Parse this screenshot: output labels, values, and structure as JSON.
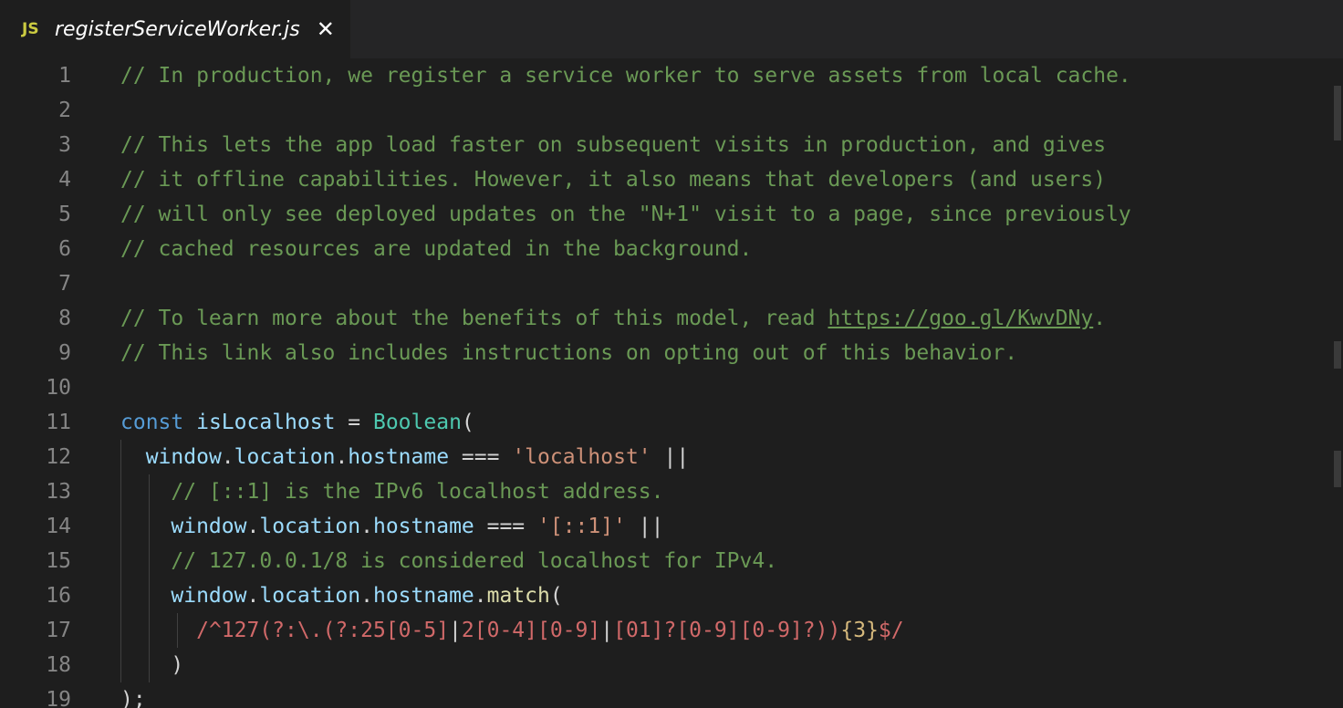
{
  "tab": {
    "badge": "JS",
    "title": "registerServiceWorker.js",
    "close": "✕"
  },
  "editor": {
    "line_numbers": [
      "1",
      "2",
      "3",
      "4",
      "5",
      "6",
      "7",
      "8",
      "9",
      "10",
      "11",
      "12",
      "13",
      "14",
      "15",
      "16",
      "17",
      "18",
      "19"
    ],
    "lines": [
      {
        "tokens": [
          {
            "t": "// In production, we register a service worker to serve assets from local cache.",
            "c": "c"
          }
        ]
      },
      {
        "tokens": []
      },
      {
        "tokens": [
          {
            "t": "// This lets the app load faster on subsequent visits in production, and gives",
            "c": "c"
          }
        ]
      },
      {
        "tokens": [
          {
            "t": "// it offline capabilities. However, it also means that developers (and users)",
            "c": "c"
          }
        ]
      },
      {
        "tokens": [
          {
            "t": "// will only see deployed updates on the \"N+1\" visit to a page, since previously",
            "c": "c"
          }
        ]
      },
      {
        "tokens": [
          {
            "t": "// cached resources are updated in the background.",
            "c": "c"
          }
        ]
      },
      {
        "tokens": []
      },
      {
        "tokens": [
          {
            "t": "// To learn more about the benefits of this model, read ",
            "c": "c"
          },
          {
            "t": "https://goo.gl/KwvDNy",
            "c": "c-link"
          },
          {
            "t": ".",
            "c": "c"
          }
        ]
      },
      {
        "tokens": [
          {
            "t": "// This link also includes instructions on opting out of this behavior.",
            "c": "c"
          }
        ]
      },
      {
        "tokens": []
      },
      {
        "tokens": [
          {
            "t": "const",
            "c": "kw"
          },
          {
            "t": " ",
            "c": "op"
          },
          {
            "t": "isLocalhost",
            "c": "var"
          },
          {
            "t": " = ",
            "c": "op"
          },
          {
            "t": "Boolean",
            "c": "type"
          },
          {
            "t": "(",
            "c": "op"
          }
        ]
      },
      {
        "tokens": [
          {
            "t": "  ",
            "c": "op"
          },
          {
            "t": "window",
            "c": "var"
          },
          {
            "t": ".",
            "c": "op"
          },
          {
            "t": "location",
            "c": "var"
          },
          {
            "t": ".",
            "c": "op"
          },
          {
            "t": "hostname",
            "c": "var"
          },
          {
            "t": " === ",
            "c": "op"
          },
          {
            "t": "'localhost'",
            "c": "str"
          },
          {
            "t": " ||",
            "c": "op"
          }
        ]
      },
      {
        "tokens": [
          {
            "t": "    ",
            "c": "op"
          },
          {
            "t": "// [::1] is the IPv6 localhost address.",
            "c": "c"
          }
        ]
      },
      {
        "tokens": [
          {
            "t": "    ",
            "c": "op"
          },
          {
            "t": "window",
            "c": "var"
          },
          {
            "t": ".",
            "c": "op"
          },
          {
            "t": "location",
            "c": "var"
          },
          {
            "t": ".",
            "c": "op"
          },
          {
            "t": "hostname",
            "c": "var"
          },
          {
            "t": " === ",
            "c": "op"
          },
          {
            "t": "'[::1]'",
            "c": "str"
          },
          {
            "t": " ||",
            "c": "op"
          }
        ]
      },
      {
        "tokens": [
          {
            "t": "    ",
            "c": "op"
          },
          {
            "t": "// 127.0.0.1/8 is considered localhost for IPv4.",
            "c": "c"
          }
        ]
      },
      {
        "tokens": [
          {
            "t": "    ",
            "c": "op"
          },
          {
            "t": "window",
            "c": "var"
          },
          {
            "t": ".",
            "c": "op"
          },
          {
            "t": "location",
            "c": "var"
          },
          {
            "t": ".",
            "c": "op"
          },
          {
            "t": "hostname",
            "c": "var"
          },
          {
            "t": ".",
            "c": "op"
          },
          {
            "t": "match",
            "c": "fn"
          },
          {
            "t": "(",
            "c": "op"
          }
        ]
      },
      {
        "tokens": [
          {
            "t": "      ",
            "c": "op"
          },
          {
            "t": "/^127(?:\\.(?:25[0-5]",
            "c": "re"
          },
          {
            "t": "|",
            "c": "op"
          },
          {
            "t": "2[0-4][0-9]",
            "c": "re"
          },
          {
            "t": "|",
            "c": "op"
          },
          {
            "t": "[01]?[0-9][0-9]?))",
            "c": "re"
          },
          {
            "t": "{3}",
            "c": "rep"
          },
          {
            "t": "$/",
            "c": "re"
          }
        ]
      },
      {
        "tokens": [
          {
            "t": "    )",
            "c": "op"
          }
        ]
      },
      {
        "tokens": [
          {
            "t": ");",
            "c": "op"
          }
        ]
      }
    ]
  },
  "colors": {
    "background": "#1e1e1e",
    "tabbar": "#252526",
    "comment": "#6a9955",
    "keyword": "#569cd6",
    "variable": "#9cdcfe",
    "type": "#4ec9b0",
    "string": "#ce9178",
    "regex": "#d16969",
    "line_number": "#858585"
  }
}
